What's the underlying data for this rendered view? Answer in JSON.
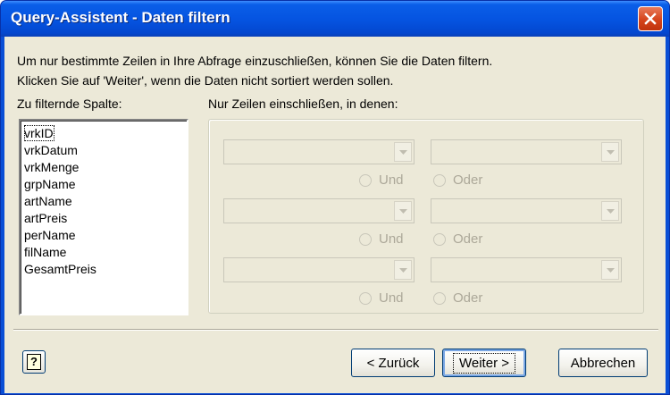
{
  "window": {
    "title": "Query-Assistent - Daten filtern"
  },
  "intro": {
    "line1": "Um nur bestimmte Zeilen in Ihre Abfrage einzuschließen, können Sie die Daten filtern.",
    "line2": "Klicken Sie auf 'Weiter', wenn die Daten nicht sortiert werden sollen."
  },
  "column_list": {
    "label": "Zu filternde Spalte:",
    "items": [
      "vrkID",
      "vrkDatum",
      "vrkMenge",
      "grpName",
      "artName",
      "artPreis",
      "perName",
      "filName",
      "GesamtPreis"
    ],
    "focused": "vrkID"
  },
  "filter": {
    "label": "Nur Zeilen einschließen, in denen:",
    "rows": [
      {
        "operator": "",
        "value": "",
        "and_label": "Und",
        "or_label": "Oder"
      },
      {
        "operator": "",
        "value": "",
        "and_label": "Und",
        "or_label": "Oder"
      },
      {
        "operator": "",
        "value": "",
        "and_label": "Und",
        "or_label": "Oder"
      }
    ]
  },
  "buttons": {
    "help": "?",
    "back": "< Zurück",
    "next": "Weiter >",
    "cancel": "Abbrechen"
  },
  "colors": {
    "titlebar": "#0553e0",
    "client_bg": "#ece9d8",
    "disabled_text": "#aca899",
    "close_button": "#d5441c"
  }
}
